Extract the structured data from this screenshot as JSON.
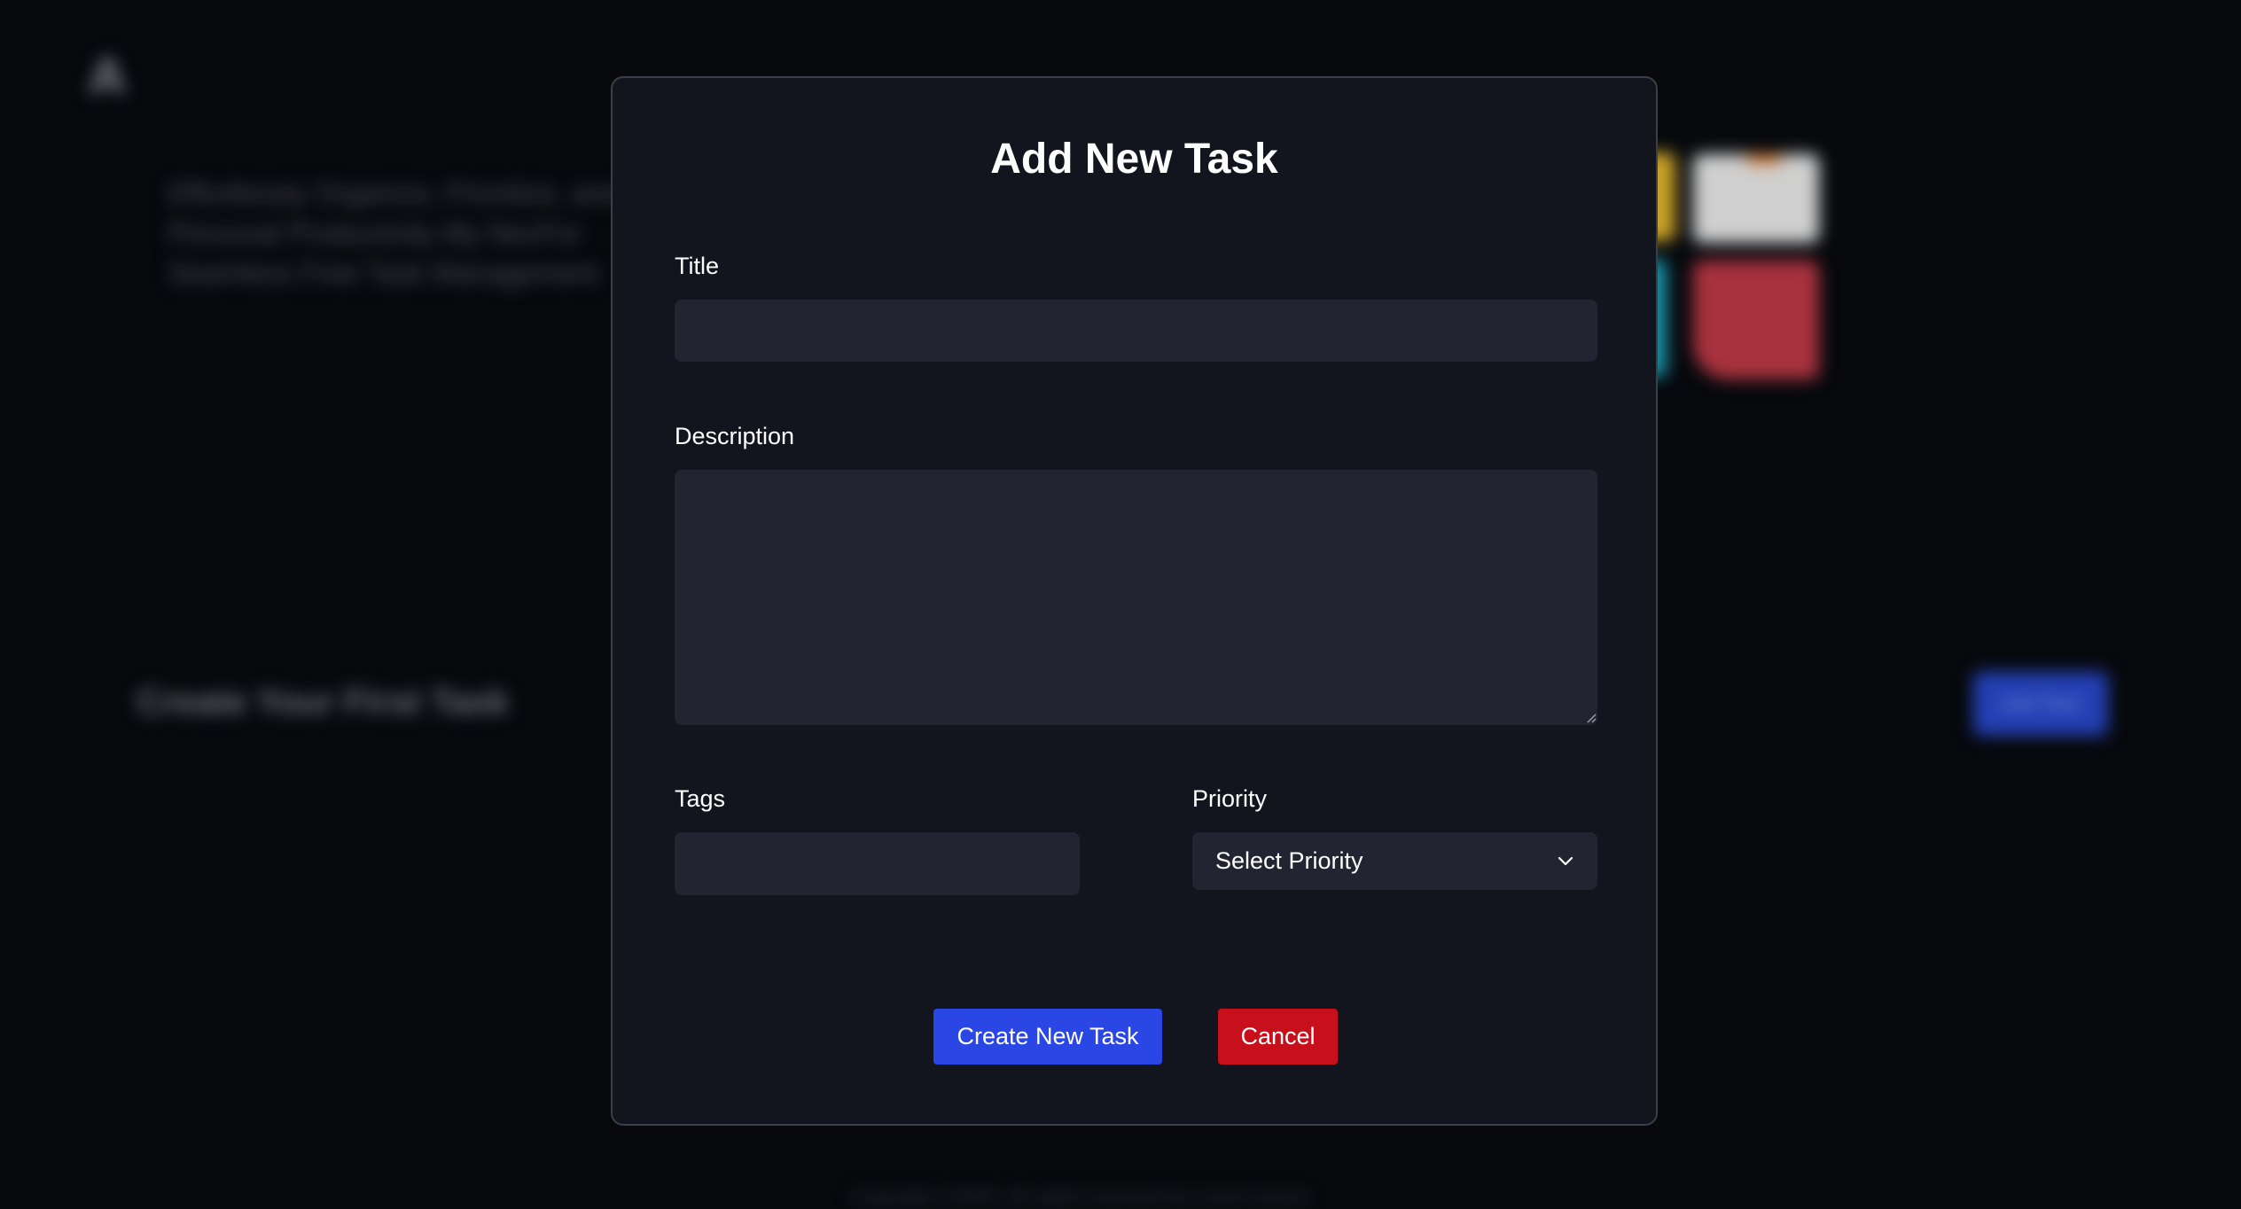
{
  "background": {
    "hero_text": "Effortlessly Organize, Prioritize, and Personal Productivity My NexFor Seamless Free Task Management",
    "first_task_heading": "Create Your First Task",
    "add_task_button": "Add Task",
    "footer_text": "Copyright ©2025. All rights reserved by Lorem Ipsum"
  },
  "modal": {
    "title": "Add New Task",
    "fields": {
      "title_label": "Title",
      "title_value": "",
      "description_label": "Description",
      "description_value": "",
      "tags_label": "Tags",
      "tags_value": "",
      "priority_label": "Priority",
      "priority_selected": "Select Priority"
    },
    "buttons": {
      "create": "Create New Task",
      "cancel": "Cancel"
    }
  },
  "colors": {
    "accent": "#2a47e6",
    "danger": "#c8101c",
    "modal_bg": "#12151d",
    "field_bg": "#222531"
  }
}
